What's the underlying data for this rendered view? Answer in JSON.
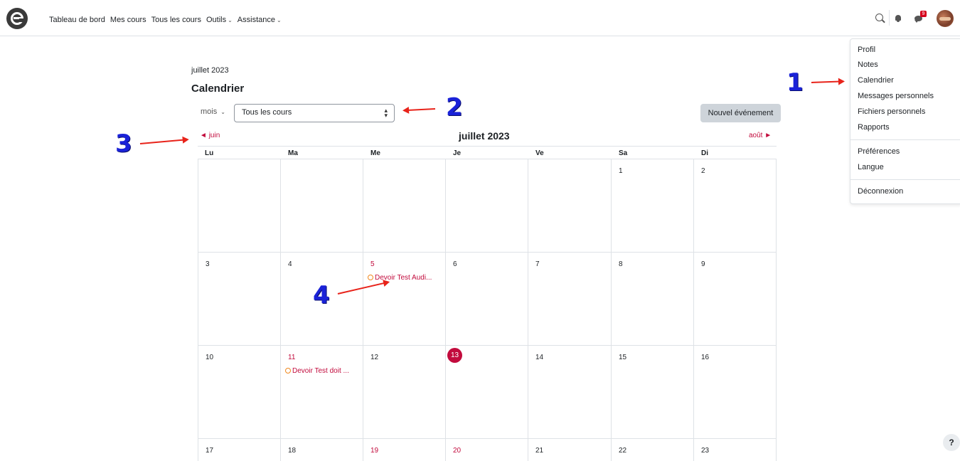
{
  "nav": {
    "links": [
      "Tableau de bord",
      "Mes cours",
      "Tous les cours",
      "Outils",
      "Assistance"
    ],
    "message_count": "9"
  },
  "user_menu": {
    "group1": [
      "Profil",
      "Notes",
      "Calendrier",
      "Messages personnels",
      "Fichiers personnels",
      "Rapports"
    ],
    "group2": [
      "Préférences",
      "Langue"
    ],
    "logout": "Déconnexion"
  },
  "page": {
    "breadcrumb": "juillet 2023",
    "title": "Calendrier",
    "view_select": "mois",
    "course_select": "Tous les cours",
    "new_event": "Nouvel événement",
    "prev_month": "juin",
    "next_month": "août",
    "current_month": "juillet 2023"
  },
  "calendar": {
    "weekdays": [
      "Lu",
      "Ma",
      "Me",
      "Je",
      "Ve",
      "Sa",
      "Di"
    ],
    "weeks": [
      [
        "",
        "",
        "",
        "",
        "",
        "1",
        "2"
      ],
      [
        "3",
        "4",
        "5",
        "6",
        "7",
        "8",
        "9"
      ],
      [
        "10",
        "11",
        "12",
        "13",
        "14",
        "15",
        "16"
      ],
      [
        "17",
        "18",
        "19",
        "20",
        "21",
        "22",
        "23"
      ]
    ],
    "today": "13",
    "event_days": [
      "5",
      "11",
      "19",
      "20"
    ],
    "events": [
      {
        "day": "5",
        "label": "Devoir Test Audi..."
      },
      {
        "day": "11",
        "label": "Devoir Test doit ..."
      }
    ]
  },
  "annotations": [
    "1",
    "2",
    "3",
    "4"
  ],
  "help": "?",
  "colors": {
    "accent": "#c20b3d",
    "annotation_number": "#1a22d8",
    "annotation_arrow": "#e8231a"
  }
}
